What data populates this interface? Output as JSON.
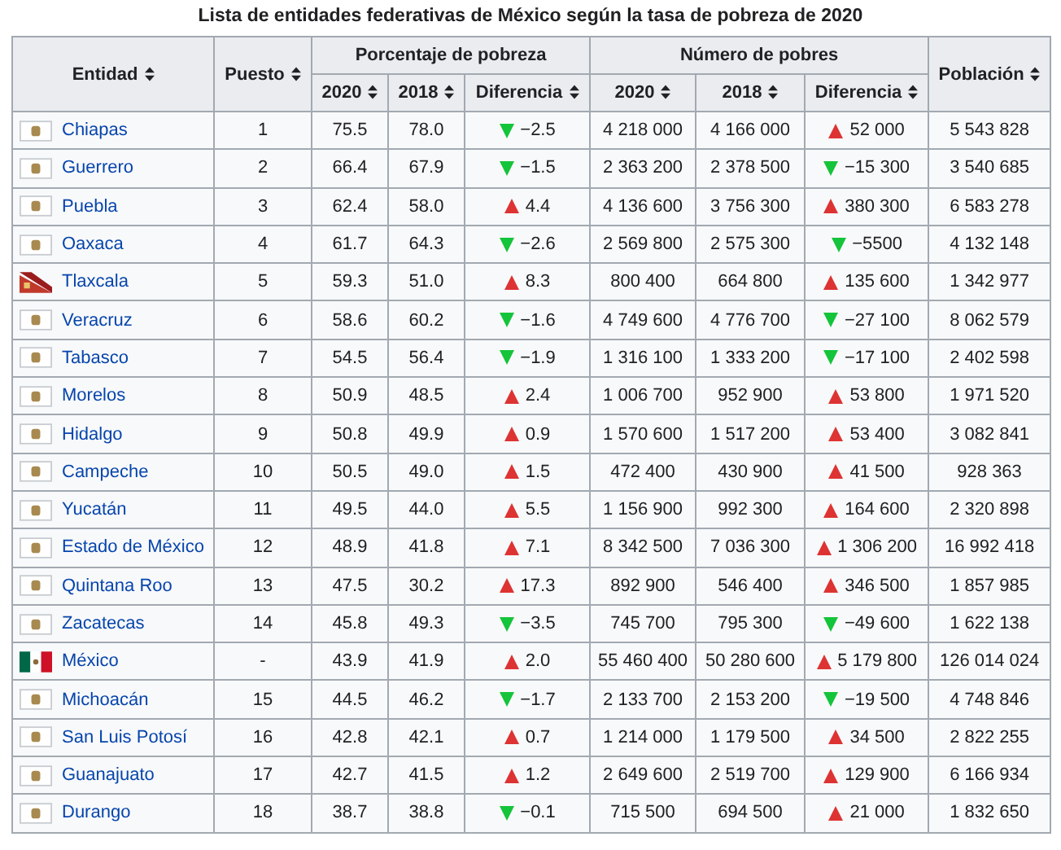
{
  "caption": "Lista de entidades federativas de México según la tasa de pobreza de 2020",
  "header": {
    "entity": "Entidad",
    "rank": "Puesto",
    "percent_group": "Porcentaje de pobreza",
    "count_group": "Número de pobres",
    "population": "Población",
    "percent_sub": [
      "2020",
      "2018",
      "Diferencia"
    ],
    "count_sub": [
      "2020",
      "2018",
      "Diferencia"
    ]
  },
  "rows": [
    {
      "kind": "coat",
      "entity": "Chiapas",
      "rank": "1",
      "pct_2020": "75.5",
      "pct_2018": "78.0",
      "pct_increase": false,
      "pct_diff": "−2.5",
      "poor_2020": "4 218 000",
      "poor_2018": "4 166 000",
      "poor_increase": true,
      "poor_diff": "52 000",
      "population": "5 543 828"
    },
    {
      "kind": "coat",
      "entity": "Guerrero",
      "rank": "2",
      "pct_2020": "66.4",
      "pct_2018": "67.9",
      "pct_increase": false,
      "pct_diff": "−1.5",
      "poor_2020": "2 363 200",
      "poor_2018": "2 378 500",
      "poor_increase": false,
      "poor_diff": "−15 300",
      "population": "3 540 685"
    },
    {
      "kind": "coat",
      "entity": "Puebla",
      "rank": "3",
      "pct_2020": "62.4",
      "pct_2018": "58.0",
      "pct_increase": true,
      "pct_diff": "4.4",
      "poor_2020": "4 136 600",
      "poor_2018": "3 756 300",
      "poor_increase": true,
      "poor_diff": "380 300",
      "population": "6 583 278"
    },
    {
      "kind": "coat",
      "entity": "Oaxaca",
      "rank": "4",
      "pct_2020": "61.7",
      "pct_2018": "64.3",
      "pct_increase": false,
      "pct_diff": "−2.6",
      "poor_2020": "2 569 800",
      "poor_2018": "2 575 300",
      "poor_increase": false,
      "poor_diff": "−5500",
      "population": "4 132 148"
    },
    {
      "kind": "pennant",
      "entity": "Tlaxcala",
      "rank": "5",
      "pct_2020": "59.3",
      "pct_2018": "51.0",
      "pct_increase": true,
      "pct_diff": "8.3",
      "poor_2020": "800 400",
      "poor_2018": "664 800",
      "poor_increase": true,
      "poor_diff": "135 600",
      "population": "1 342 977"
    },
    {
      "kind": "coat",
      "entity": "Veracruz",
      "rank": "6",
      "pct_2020": "58.6",
      "pct_2018": "60.2",
      "pct_increase": false,
      "pct_diff": "−1.6",
      "poor_2020": "4 749 600",
      "poor_2018": "4 776 700",
      "poor_increase": false,
      "poor_diff": "−27 100",
      "population": "8 062 579"
    },
    {
      "kind": "coat",
      "entity": "Tabasco",
      "rank": "7",
      "pct_2020": "54.5",
      "pct_2018": "56.4",
      "pct_increase": false,
      "pct_diff": "−1.9",
      "poor_2020": "1 316 100",
      "poor_2018": "1 333 200",
      "poor_increase": false,
      "poor_diff": "−17 100",
      "population": "2 402 598"
    },
    {
      "kind": "coat",
      "entity": "Morelos",
      "rank": "8",
      "pct_2020": "50.9",
      "pct_2018": "48.5",
      "pct_increase": true,
      "pct_diff": "2.4",
      "poor_2020": "1 006 700",
      "poor_2018": "952 900",
      "poor_increase": true,
      "poor_diff": "53 800",
      "population": "1 971 520"
    },
    {
      "kind": "coat",
      "entity": "Hidalgo",
      "rank": "9",
      "pct_2020": "50.8",
      "pct_2018": "49.9",
      "pct_increase": true,
      "pct_diff": "0.9",
      "poor_2020": "1 570 600",
      "poor_2018": "1 517 200",
      "poor_increase": true,
      "poor_diff": "53 400",
      "population": "3 082 841"
    },
    {
      "kind": "coat",
      "entity": "Campeche",
      "rank": "10",
      "pct_2020": "50.5",
      "pct_2018": "49.0",
      "pct_increase": true,
      "pct_diff": "1.5",
      "poor_2020": "472 400",
      "poor_2018": "430 900",
      "poor_increase": true,
      "poor_diff": "41 500",
      "population": "928 363"
    },
    {
      "kind": "coat",
      "entity": "Yucatán",
      "rank": "11",
      "pct_2020": "49.5",
      "pct_2018": "44.0",
      "pct_increase": true,
      "pct_diff": "5.5",
      "poor_2020": "1 156 900",
      "poor_2018": "992 300",
      "poor_increase": true,
      "poor_diff": "164 600",
      "population": "2 320 898"
    },
    {
      "kind": "coat",
      "entity": "Estado de México",
      "rank": "12",
      "pct_2020": "48.9",
      "pct_2018": "41.8",
      "pct_increase": true,
      "pct_diff": "7.1",
      "poor_2020": "8 342 500",
      "poor_2018": "7 036 300",
      "poor_increase": true,
      "poor_diff": "1 306 200",
      "population": "16 992 418"
    },
    {
      "kind": "coat",
      "entity": "Quintana Roo",
      "rank": "13",
      "pct_2020": "47.5",
      "pct_2018": "30.2",
      "pct_increase": true,
      "pct_diff": "17.3",
      "poor_2020": "892 900",
      "poor_2018": "546 400",
      "poor_increase": true,
      "poor_diff": "346 500",
      "population": "1 857 985"
    },
    {
      "kind": "coat",
      "entity": "Zacatecas",
      "rank": "14",
      "pct_2020": "45.8",
      "pct_2018": "49.3",
      "pct_increase": false,
      "pct_diff": "−3.5",
      "poor_2020": "745 700",
      "poor_2018": "795 300",
      "poor_increase": false,
      "poor_diff": "−49 600",
      "population": "1 622 138"
    },
    {
      "kind": "tricolor",
      "entity": "México",
      "rank": "-",
      "pct_2020": "43.9",
      "pct_2018": "41.9",
      "pct_increase": true,
      "pct_diff": "2.0",
      "poor_2020": "55 460 400",
      "poor_2018": "50 280 600",
      "poor_increase": true,
      "poor_diff": "5 179 800",
      "population": "126 014 024"
    },
    {
      "kind": "coat",
      "entity": "Michoacán",
      "rank": "15",
      "pct_2020": "44.5",
      "pct_2018": "46.2",
      "pct_increase": false,
      "pct_diff": "−1.7",
      "poor_2020": "2 133 700",
      "poor_2018": "2 153 200",
      "poor_increase": false,
      "poor_diff": "−19 500",
      "population": "4 748 846"
    },
    {
      "kind": "coat",
      "entity": "San Luis Potosí",
      "rank": "16",
      "pct_2020": "42.8",
      "pct_2018": "42.1",
      "pct_increase": true,
      "pct_diff": "0.7",
      "poor_2020": "1 214 000",
      "poor_2018": "1 179 500",
      "poor_increase": true,
      "poor_diff": "34 500",
      "population": "2 822 255"
    },
    {
      "kind": "coat",
      "entity": "Guanajuato",
      "rank": "17",
      "pct_2020": "42.7",
      "pct_2018": "41.5",
      "pct_increase": true,
      "pct_diff": "1.2",
      "poor_2020": "2 649 600",
      "poor_2018": "2 519 700",
      "poor_increase": true,
      "poor_diff": "129 900",
      "population": "6 166 934"
    },
    {
      "kind": "coat",
      "entity": "Durango",
      "rank": "18",
      "pct_2020": "38.7",
      "pct_2018": "38.8",
      "pct_increase": false,
      "pct_diff": "−0.1",
      "poor_2020": "715 500",
      "poor_2018": "694 500",
      "poor_increase": true,
      "poor_diff": "21 000",
      "population": "1 832 650"
    }
  ]
}
